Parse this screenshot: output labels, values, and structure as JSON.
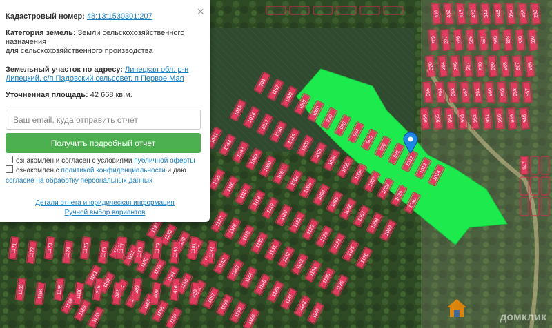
{
  "popup": {
    "cad_label": "Кадастровый номер:",
    "cad_value": "48:13:1530301:207",
    "category_label": "Категория земель:",
    "category_value_1": "Земли сельскохозяйственного назначения",
    "category_value_2": "для сельскохозяйственного производства",
    "address_label": "Земельный участок по адресу:",
    "address_value": "Липецкая обл, р-н Липецкий, с/п Падовский сельсовет, п Первое Мая",
    "area_label": "Уточненная площадь:",
    "area_value": "42 668 кв.м.",
    "email_placeholder": "Ваш email, куда отправить отчет",
    "submit_label": "Получить подробный отчет",
    "consent1_pre": "ознакомлен и согласен с условиями",
    "consent1_link": "публичной оферты",
    "consent2_pre": "ознакомлен с",
    "consent2_link": "политикой конфиденциальности",
    "consent2_mid": "и даю",
    "consent2_link2": "согласие на обработку персональных данных",
    "details_link": "Детали отчета и юридическая информация",
    "manual_link": "Ручной выбор вариантов",
    "close_glyph": "×"
  },
  "map": {
    "plot_labels": [
      "204",
      "1187",
      "1002",
      "1001",
      "1000",
      "999",
      "998",
      "994",
      "993",
      "992",
      "991",
      "1012",
      "1013",
      "1014",
      "1015",
      "1016",
      "1017",
      "1018",
      "1019",
      "1020",
      "1021",
      "1034",
      "1035",
      "1036",
      "1037",
      "1038",
      "1039",
      "1040",
      "1041",
      "1042",
      "1043",
      "1059",
      "1060",
      "1061",
      "1062",
      "1063",
      "1064",
      "1065",
      "1066",
      "1067",
      "1068",
      "1069",
      "1115",
      "1116",
      "1117",
      "1118",
      "1119",
      "1120",
      "1121",
      "1122",
      "1123",
      "1124",
      "1125",
      "1126",
      "1127",
      "1128",
      "1129",
      "1130",
      "1131",
      "1132",
      "1133",
      "1134",
      "1135",
      "1136",
      "1137",
      "1138",
      "1139",
      "1140",
      "1141",
      "1142",
      "1143",
      "1144",
      "1145",
      "1146",
      "1147",
      "1148",
      "1149",
      "1150",
      "1151",
      "1152",
      "1153",
      "1154",
      "1155",
      "1156",
      "1157",
      "1158",
      "1159",
      "1160",
      "1161",
      "1162",
      "1163",
      "1164",
      "1165",
      "1166",
      "1167",
      "1168",
      "1169",
      "1170",
      "1171",
      "1172",
      "1173",
      "1174",
      "1175",
      "1176",
      "1177",
      "1178",
      "1179",
      "1180",
      "1181",
      "1182",
      "1183",
      "1184",
      "1185",
      "1186",
      "376",
      "382",
      "389",
      "409",
      "416",
      "423",
      "431",
      "432",
      "413",
      "420",
      "342",
      "348",
      "355",
      "356",
      "290",
      "269",
      "277",
      "286",
      "586",
      "591",
      "598",
      "368",
      "378",
      "319",
      "329",
      "284",
      "296",
      "257",
      "970",
      "969",
      "968",
      "967",
      "966",
      "965",
      "964",
      "963",
      "962",
      "961",
      "960",
      "959",
      "958",
      "957",
      "956",
      "955",
      "954",
      "953",
      "952",
      "951",
      "950",
      "949",
      "948",
      "947"
    ]
  },
  "watermark": "домклик"
}
